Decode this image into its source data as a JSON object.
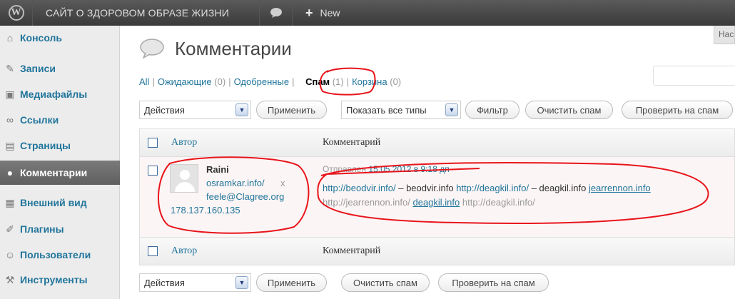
{
  "adminbar": {
    "logo": "W",
    "site_name": "Сайт о здоровом образе жизни",
    "comments_icon": "speech-bubble-icon",
    "new_label": "New"
  },
  "sidebar": {
    "items": [
      {
        "label": "Консоль",
        "icon": "home-icon",
        "glyph": "⌂"
      },
      {
        "label": "Записи",
        "icon": "pushpin-icon",
        "glyph": "✎"
      },
      {
        "label": "Медиафайлы",
        "icon": "media-icon",
        "glyph": "▣"
      },
      {
        "label": "Ссылки",
        "icon": "link-icon",
        "glyph": "∞"
      },
      {
        "label": "Страницы",
        "icon": "pages-icon",
        "glyph": "▤"
      },
      {
        "label": "Комментарии",
        "icon": "comments-icon",
        "glyph": "●"
      },
      {
        "label": "Внешний вид",
        "icon": "appearance-icon",
        "glyph": "▦"
      },
      {
        "label": "Плагины",
        "icon": "plugins-icon",
        "glyph": "✐"
      },
      {
        "label": "Пользователи",
        "icon": "users-icon",
        "glyph": "☺"
      },
      {
        "label": "Инструменты",
        "icon": "tools-icon",
        "glyph": "⚒"
      }
    ],
    "active_index": 5
  },
  "page": {
    "title": "Комментарии",
    "help_tab": "Нас"
  },
  "filters": {
    "all": "All",
    "pending": "Ожидающие",
    "pending_count": "(0)",
    "approved": "Одобренные",
    "spam": "Спам",
    "spam_count": "(1)",
    "trash": "Корзина",
    "trash_count": "(0)",
    "sep": "|"
  },
  "toolbar_top": {
    "bulk_action": "Действия",
    "apply": "Применить",
    "type_filter": "Показать все типы",
    "filter": "Фильтр",
    "empty_spam": "Очистить спам",
    "check_spam": "Проверить на спам"
  },
  "table": {
    "col_author": "Автор",
    "col_comment": "Комментарий"
  },
  "comment": {
    "author_name": "Raini",
    "author_url": "osramkar.info/",
    "author_url_x": "x",
    "author_email": "feele@Clagree.org",
    "author_ip": "178.137.160.135",
    "submitted_prefix": "Отправлен",
    "submitted_date": "15.05.2012 в 9:18 дп",
    "line1": [
      {
        "text": "http://beodvir.info/",
        "link": true
      },
      {
        "text": " – beodvir.info ",
        "link": false
      },
      {
        "text": "http://deagkil.info/",
        "link": true
      },
      {
        "text": " – deagkil.info ",
        "link": false
      },
      {
        "text": "jearrennon.info",
        "link": true,
        "underline": true
      }
    ],
    "line2": [
      {
        "text": "http://jearrennon.info/ ",
        "link": false
      },
      {
        "text": "deagkil.info",
        "link": true,
        "underline": true
      },
      {
        "text": " http://deagkil.info/",
        "link": false
      }
    ]
  },
  "toolbar_bottom": {
    "bulk_action": "Действия",
    "apply": "Применить",
    "empty_spam": "Очистить спам",
    "check_spam": "Проверить на спам"
  },
  "colors": {
    "adminbar": "#464646",
    "link": "#21759b",
    "annotation": "#e8141b"
  }
}
